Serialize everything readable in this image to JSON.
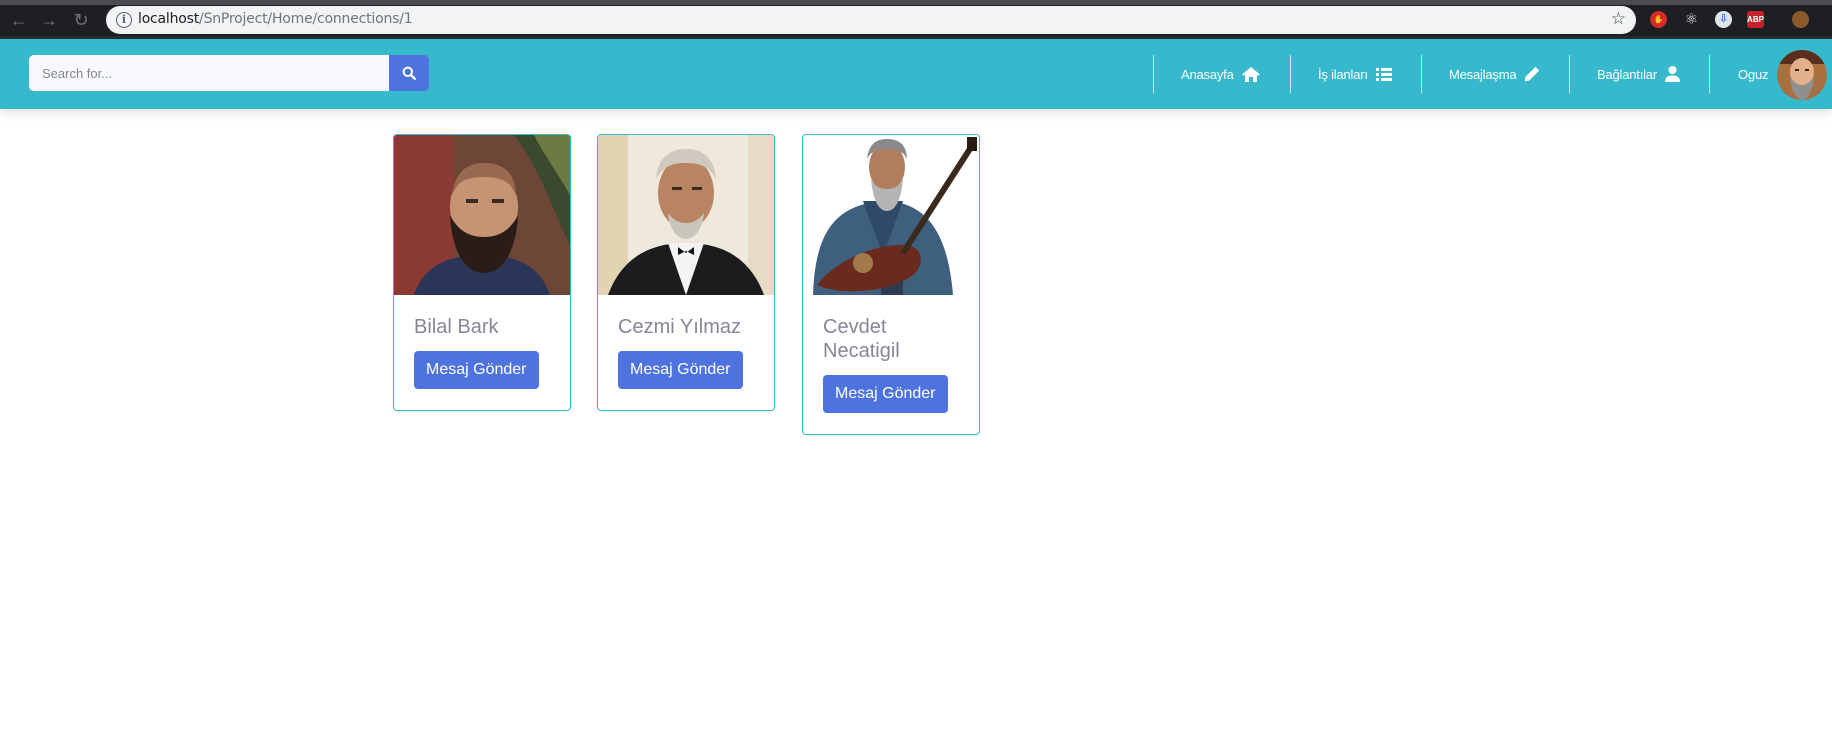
{
  "browser": {
    "url_host": "localhost",
    "url_path": "/SnProject/Home/connections/1",
    "extensions": [
      "red-hand-extension-icon",
      "react-devtools-icon",
      "download-extension-icon",
      "adblock-plus-icon",
      "profile-icon"
    ],
    "abp_label": "ABP"
  },
  "header": {
    "search": {
      "placeholder": "Search for..."
    },
    "nav": [
      {
        "label": "Anasayfa",
        "icon": "home-icon"
      },
      {
        "label": "İş ilanları",
        "icon": "list-icon"
      },
      {
        "label": "Mesajlaşma",
        "icon": "pencil-icon"
      },
      {
        "label": "Bağlantılar",
        "icon": "user-icon"
      }
    ],
    "user": {
      "name": "Oguz"
    }
  },
  "connections": [
    {
      "name": "Bilal Bark",
      "button": "Mesaj Gönder"
    },
    {
      "name": "Cezmi Yılmaz",
      "button": "Mesaj Gönder"
    },
    {
      "name": "Cevdet Necatigil",
      "button": "Mesaj Gönder"
    }
  ],
  "colors": {
    "topbar": "#36b9cc",
    "primary": "#4e73df",
    "card_border": "#36b9cc",
    "name_text": "#858796"
  }
}
